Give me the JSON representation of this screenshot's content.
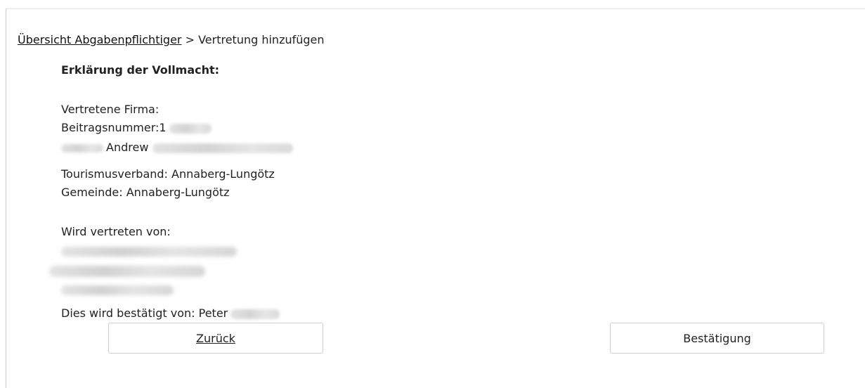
{
  "breadcrumb": {
    "link": "Übersicht Abgabenpflichtiger",
    "separator": ">",
    "current": "Vertretung hinzufügen"
  },
  "declaration": {
    "title": "Erklärung der Vollmacht:",
    "represented_company_label": "Vertretene Firma:",
    "contribution_number_label": "Beitragsnummer:1",
    "name_visible_part": "Andrew",
    "tourism_association": "Tourismusverband: Annaberg-Lungötz",
    "municipality": "Gemeinde: Annaberg-Lungötz",
    "represented_by_label": "Wird vertreten von:",
    "confirmed_by": "Dies wird bestätigt von: Peter"
  },
  "buttons": {
    "back": "Zurück",
    "confirm": "Bestätigung"
  }
}
